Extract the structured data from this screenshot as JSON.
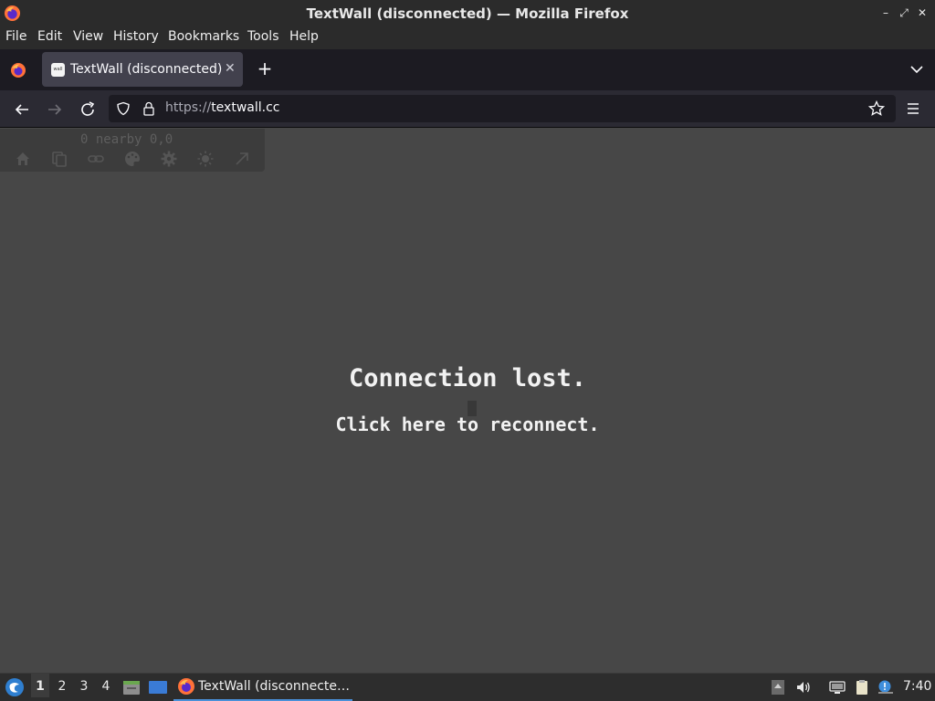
{
  "window": {
    "title": "TextWall (disconnected) — Mozilla Firefox"
  },
  "menu": {
    "items": [
      "File",
      "Edit",
      "View",
      "History",
      "Bookmarks",
      "Tools",
      "Help"
    ]
  },
  "tabs": [
    {
      "label": "TextWall (disconnected)",
      "favicon_text": "wall"
    }
  ],
  "navbar": {
    "url_scheme": "https://",
    "url_host": "textwall.cc"
  },
  "page": {
    "toolbar_status": "0 nearby  0,0",
    "toolbar_icons": [
      "home-icon",
      "copy-icon",
      "link-icon",
      "palette-icon",
      "gear-icon",
      "sun-icon",
      "arrow-up-right-icon"
    ],
    "title": "Connection lost.",
    "action": "Click here to reconnect."
  },
  "taskbar": {
    "workspaces": [
      "1",
      "2",
      "3",
      "4"
    ],
    "active_workspace": "1",
    "task_label": "TextWall (disconnecte…",
    "clock": "7:40"
  },
  "colors": {
    "page_bg": "#474747",
    "chrome_dark": "#1c1b22",
    "taskbar_accent": "#4a90d9"
  }
}
